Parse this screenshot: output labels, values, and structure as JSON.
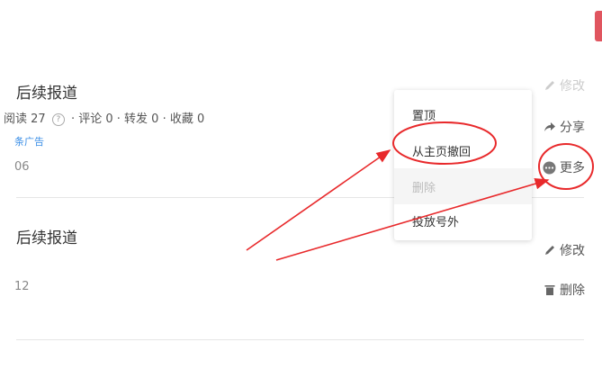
{
  "articles": [
    {
      "title": "后续报道",
      "read_label": "阅读",
      "read_count": "27",
      "stats_rest": "·  评论 0  ·  转发 0  ·  收藏 0",
      "tag": "条广告",
      "date": "06"
    },
    {
      "title": "后续报道",
      "date": "12"
    }
  ],
  "actions": {
    "edit_top": "修改",
    "share": "分享",
    "more": "更多",
    "edit": "修改",
    "delete": "删除"
  },
  "menu": {
    "pin": "置顶",
    "withdraw": "从主页撤回",
    "delete": "删除",
    "ad": "投放号外"
  },
  "colors": {
    "annotation_red": "#e8292b",
    "link_blue": "#3a8ee6",
    "pink_corner": "#e0555f"
  },
  "icons": [
    "pencil-icon",
    "share-icon",
    "more-dots-icon",
    "trash-icon",
    "help-icon"
  ]
}
